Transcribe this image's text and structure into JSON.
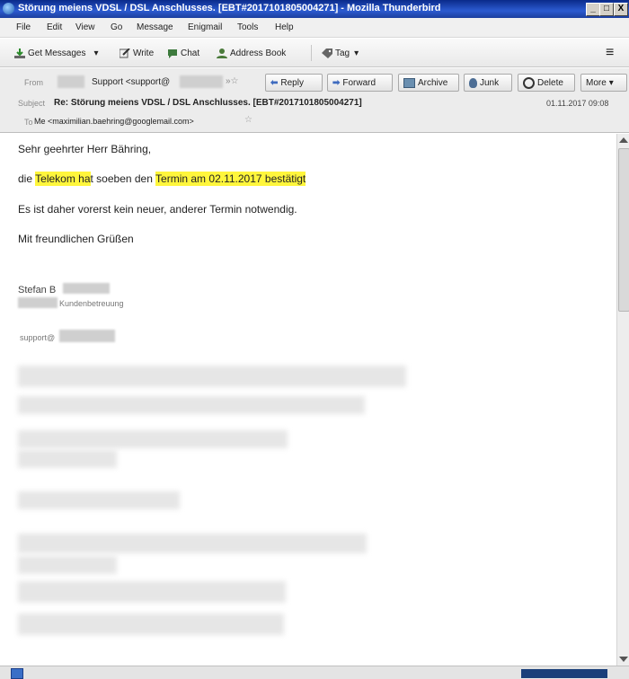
{
  "window": {
    "title": "Störung meiens VDSL / DSL Anschlusses. [EBT#2017101805004271] - Mozilla Thunderbird",
    "controls": [
      "_",
      "□",
      "X"
    ]
  },
  "menu": [
    "File",
    "Edit",
    "View",
    "Go",
    "Message",
    "Enigmail",
    "Tools",
    "Help"
  ],
  "toolbar": {
    "get_messages": "Get Messages",
    "write": "Write",
    "chat": "Chat",
    "address_book": "Address Book",
    "tag": "Tag"
  },
  "header": {
    "from_label": "From",
    "from_value": "Support <support@",
    "subject_label": "Subject",
    "subject_value": "Re: Störung meiens VDSL / DSL Anschlusses. [EBT#2017101805004271]",
    "to_label": "To",
    "to_value": "Me <maximilian.baehring@googlemail.com>",
    "date": "01.11.2017 09:08",
    "actions": {
      "reply": "Reply",
      "forward": "Forward",
      "archive": "Archive",
      "junk": "Junk",
      "delete": "Delete",
      "more": "More"
    }
  },
  "body": {
    "greeting": "Sehr geehrter Herr Bähring,",
    "line1_pre": "die",
    "line1_hl1": "Telekom ha",
    "line1_mid": "t soeben den",
    "line1_hl2": "Termin am 02.11.2017 bestätigt",
    "line2": "Es ist daher vorerst kein neuer, anderer Termin notwendig.",
    "closing": "Mit freundlichen Grüßen",
    "sig_name": "Stefan B",
    "sig_dept": "Kundenbetreuung",
    "sig_mail": "support@"
  },
  "colors": {
    "highlight": "#fff63c",
    "titlebar": "#1c3f9f"
  }
}
